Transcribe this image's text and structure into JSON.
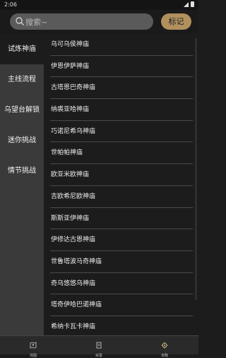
{
  "status": {
    "time": "2:06"
  },
  "search": {
    "placeholder": "搜索~",
    "note_button": "标记"
  },
  "sidebar": {
    "items": [
      "试炼神庙",
      "主线流程",
      "乌望台解锁",
      "迷你挑战",
      "情节挑战"
    ],
    "active_index": 0
  },
  "list": {
    "items": [
      "乌可乌侯神庙",
      "伊恩伊萨神庙",
      "古塔恩巴奇神庙",
      "纳裘亚哈神庙",
      "巧诺尼希乌神庙",
      "世帕帕神庙",
      "欧亚米欧神庙",
      "吉欧希尼欧神庙",
      "斯斯亚伊神庙",
      "伊修达古恩神庙",
      "世鲁塔波马奇神庙",
      "奇乌悠悠乌神庙",
      "塔奇伊哈巴诺神庙",
      "希纳卡瓦卡神庙"
    ]
  },
  "bottom_nav": {
    "tabs": [
      "地图",
      "目录",
      "攻略"
    ],
    "active_index": 2
  },
  "colors": {
    "accent": "#b0905c",
    "background": "#1c1c1c",
    "sidebar": "#3a3a3a"
  }
}
